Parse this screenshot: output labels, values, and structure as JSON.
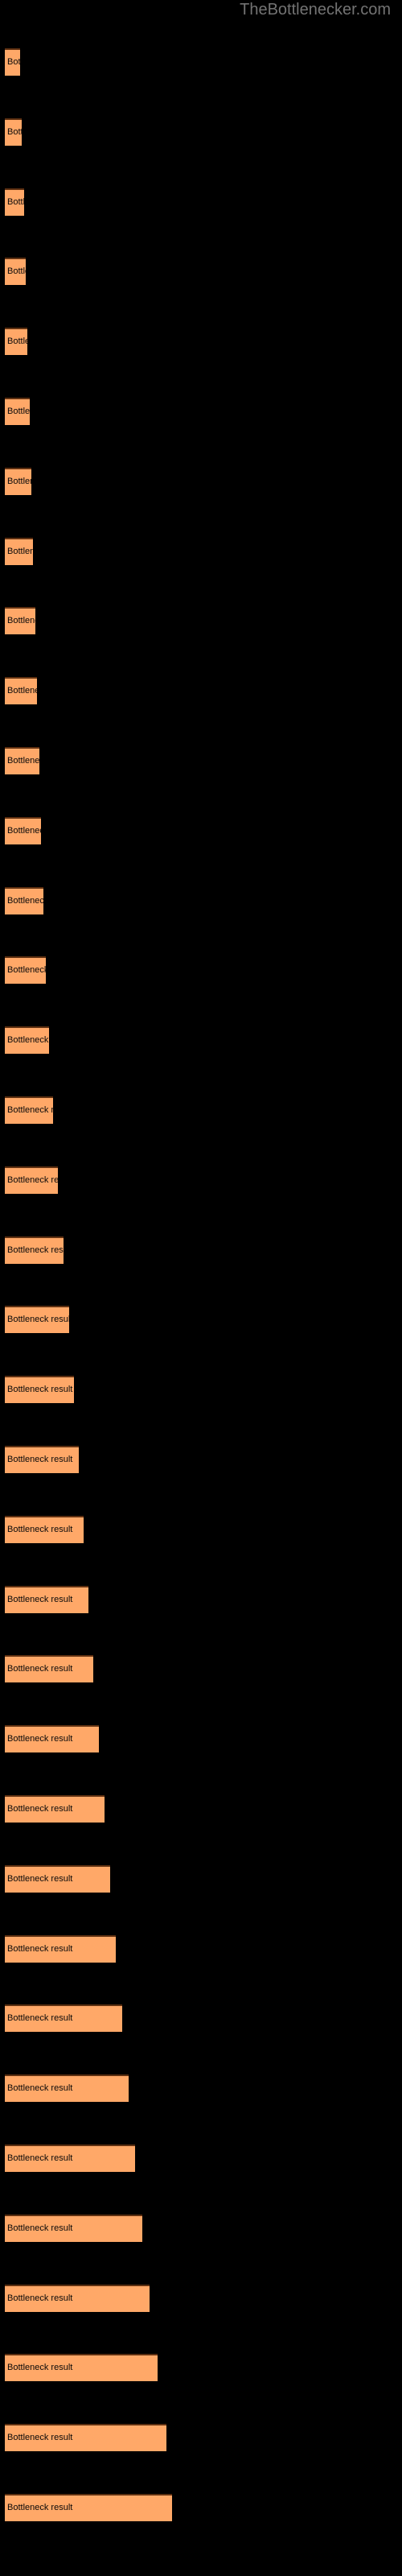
{
  "header": {
    "site_name": "TheBottlenecker.com"
  },
  "colors": {
    "background": "#000000",
    "bar_fill": "#ffa868",
    "bar_border_top": "#5e3011",
    "bar_label_text": "#0a0a0a",
    "header_text": "#737373"
  },
  "chart_data": {
    "type": "bar",
    "orientation": "horizontal",
    "title": "",
    "xlabel": "",
    "ylabel": "",
    "grid": false,
    "legend": null,
    "bar_label_text": "Bottleneck result",
    "categories": [
      "Bottleneck result",
      "Bottleneck result",
      "Bottleneck result",
      "Bottleneck result",
      "Bottleneck result",
      "Bottleneck result",
      "Bottleneck result",
      "Bottleneck result",
      "Bottleneck result",
      "Bottleneck result",
      "Bottleneck result",
      "Bottleneck result",
      "Bottleneck result",
      "Bottleneck result",
      "Bottleneck result",
      "Bottleneck result",
      "Bottleneck result",
      "Bottleneck result",
      "Bottleneck result",
      "Bottleneck result",
      "Bottleneck result",
      "Bottleneck result",
      "Bottleneck result",
      "Bottleneck result",
      "Bottleneck result",
      "Bottleneck result",
      "Bottleneck result",
      "Bottleneck result",
      "Bottleneck result",
      "Bottleneck result",
      "Bottleneck result",
      "Bottleneck result",
      "Bottleneck result",
      "Bottleneck result",
      "Bottleneck result",
      "Bottleneck result"
    ],
    "values": [
      19,
      21,
      24,
      26,
      28,
      31,
      33,
      35,
      38,
      40,
      43,
      45,
      48,
      51,
      55,
      60,
      66,
      73,
      80,
      86,
      92,
      98,
      104,
      110,
      117,
      124,
      131,
      138,
      146,
      154,
      162,
      171,
      180,
      190,
      201,
      208
    ],
    "pixel_widths": [
      19,
      21,
      24,
      26,
      28,
      31,
      33,
      35,
      38,
      40,
      43,
      45,
      48,
      51,
      55,
      60,
      66,
      73,
      80,
      86,
      92,
      98,
      104,
      110,
      117,
      124,
      131,
      138,
      146,
      154,
      162,
      171,
      180,
      190,
      201,
      208
    ],
    "bar_tops": [
      60,
      144,
      187,
      230,
      273,
      316,
      359,
      402,
      445,
      488,
      531,
      574,
      617,
      660,
      703,
      746,
      789,
      832,
      875,
      918,
      961,
      1004,
      1047,
      1090,
      1133,
      1176,
      1219,
      1262,
      1305,
      1348,
      1391,
      1434,
      1477,
      1520,
      1563,
      1606
    ]
  }
}
